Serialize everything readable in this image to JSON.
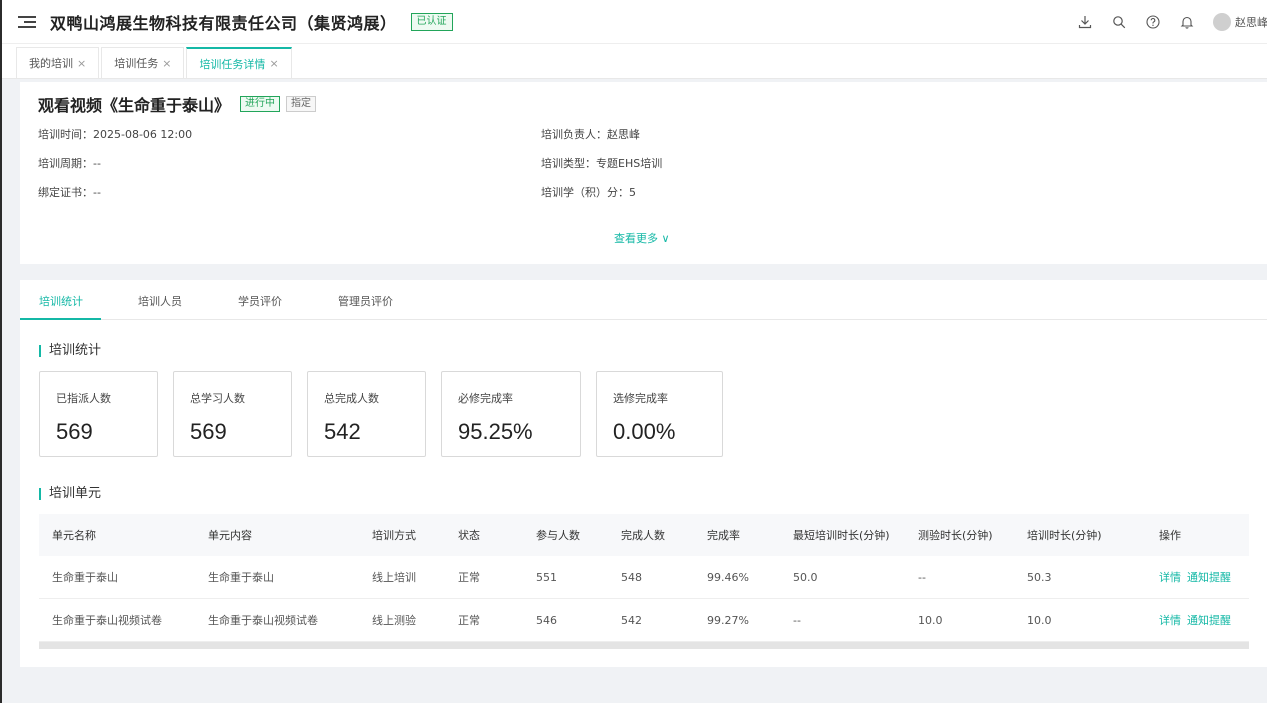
{
  "header": {
    "company_name": "双鸭山鸿展生物科技有限责任公司（集贤鸿展）",
    "verified_label": "已认证",
    "username": "赵思峰"
  },
  "page_tabs": [
    {
      "label": "我的培训",
      "close": "×"
    },
    {
      "label": "培训任务",
      "close": "×"
    },
    {
      "label": "培训任务详情",
      "close": "×"
    }
  ],
  "task": {
    "title": "观看视频《生命重于泰山》",
    "status": "进行中",
    "assign_tag": "指定",
    "training_time": "培训时间：2025-08-06 12:00",
    "training_period": "培训周期：--",
    "bound_certificate": "绑定证书：--",
    "manager": "培训负责人：赵思峰",
    "training_type": "培训类型：专题EHS培训",
    "credits": "培训学（积）分：5",
    "see_more": "查看更多 ∨"
  },
  "detail_tabs": [
    {
      "label": "培训统计"
    },
    {
      "label": "培训人员"
    },
    {
      "label": "学员评价"
    },
    {
      "label": "管理员评价"
    }
  ],
  "stats_section_title": "培训统计",
  "stats": [
    {
      "label": "已指派人数",
      "value": "569"
    },
    {
      "label": "总学习人数",
      "value": "569"
    },
    {
      "label": "总完成人数",
      "value": "542"
    },
    {
      "label": "必修完成率",
      "value": "95.25%"
    },
    {
      "label": "选修完成率",
      "value": "0.00%"
    }
  ],
  "units_section_title": "培训单元",
  "table": {
    "headers": [
      "单元名称",
      "单元内容",
      "培训方式",
      "状态",
      "参与人数",
      "完成人数",
      "完成率",
      "最短培训时长(分钟)",
      "测验时长(分钟)",
      "培训时长(分钟)",
      "操作"
    ],
    "rows": [
      {
        "name": "生命重于泰山",
        "content": "生命重于泰山",
        "method": "线上培训",
        "status": "正常",
        "participants": "551",
        "completed": "548",
        "rate": "99.46%",
        "min_duration": "50.0",
        "quiz_duration": "--",
        "duration": "50.3",
        "action_detail": "详情",
        "action_notify": "通知提醒"
      },
      {
        "name": "生命重于泰山视频试卷",
        "content": "生命重于泰山视频试卷",
        "method": "线上测验",
        "status": "正常",
        "participants": "546",
        "completed": "542",
        "rate": "99.27%",
        "min_duration": "--",
        "quiz_duration": "10.0",
        "duration": "10.0",
        "action_detail": "详情",
        "action_notify": "通知提醒"
      }
    ]
  },
  "colors": {
    "accent": "#14b8a6",
    "success": "#22a55a"
  },
  "icons": [
    "menu-collapse-icon",
    "download-icon",
    "search-icon",
    "help-icon",
    "bell-icon",
    "avatar"
  ]
}
